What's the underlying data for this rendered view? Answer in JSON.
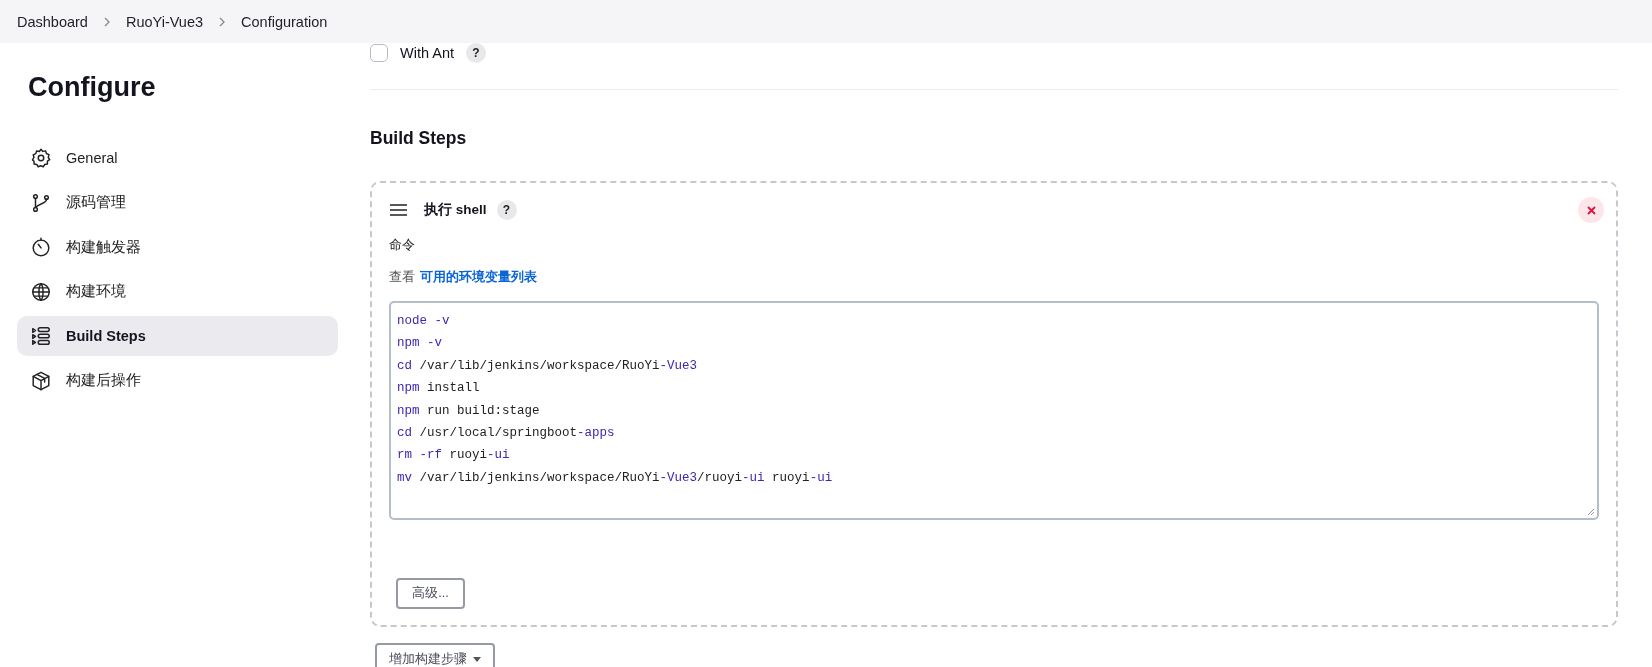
{
  "breadcrumbs": [
    {
      "label": "Dashboard"
    },
    {
      "label": "RuoYi-Vue3"
    },
    {
      "label": "Configuration"
    }
  ],
  "sidebar": {
    "title": "Configure",
    "items": [
      {
        "label": "General",
        "kind": "gear",
        "selected": false
      },
      {
        "label": "源码管理",
        "kind": "branch",
        "selected": false
      },
      {
        "label": "构建触发器",
        "kind": "timer",
        "selected": false
      },
      {
        "label": "构建环境",
        "kind": "globe",
        "selected": false
      },
      {
        "label": "Build Steps",
        "kind": "steps",
        "selected": true
      },
      {
        "label": "构建后操作",
        "kind": "package",
        "selected": false
      }
    ]
  },
  "options": [
    {
      "label": "With Ant",
      "checked": false,
      "help": "?"
    }
  ],
  "section_title": "Build Steps",
  "build_step": {
    "title": "执行 shell",
    "help": "?",
    "field_label": "命令",
    "env_prefix": "查看",
    "env_link": "可用的环境变量列表",
    "code_lines": [
      [
        {
          "text": "node",
          "kind": "keyword"
        },
        {
          "text": " -v",
          "kind": "keyword"
        }
      ],
      [
        {
          "text": "npm",
          "kind": "keyword"
        },
        {
          "text": " -v",
          "kind": "keyword"
        }
      ],
      [
        {
          "text": "cd",
          "kind": "keyword"
        },
        {
          "text": " /var/lib/jenkins/workspace/RuoYi",
          "kind": "plain"
        },
        {
          "text": "-Vue3",
          "kind": "keyword"
        }
      ],
      [
        {
          "text": "npm",
          "kind": "keyword"
        },
        {
          "text": " install",
          "kind": "plain"
        }
      ],
      [
        {
          "text": "npm",
          "kind": "keyword"
        },
        {
          "text": " run build:stage",
          "kind": "plain"
        }
      ],
      [
        {
          "text": "cd",
          "kind": "keyword"
        },
        {
          "text": " /usr/local/springboot",
          "kind": "plain"
        },
        {
          "text": "-apps",
          "kind": "keyword"
        }
      ],
      [
        {
          "text": "rm",
          "kind": "keyword"
        },
        {
          "text": " -rf",
          "kind": "keyword"
        },
        {
          "text": " ruoyi",
          "kind": "plain"
        },
        {
          "text": "-ui",
          "kind": "keyword"
        }
      ],
      [
        {
          "text": "mv",
          "kind": "keyword"
        },
        {
          "text": " /var/lib/jenkins/workspace/RuoYi",
          "kind": "plain"
        },
        {
          "text": "-Vue3",
          "kind": "keyword"
        },
        {
          "text": "/ruoyi",
          "kind": "plain"
        },
        {
          "text": "-ui",
          "kind": "keyword"
        },
        {
          "text": " ruoyi",
          "kind": "plain"
        },
        {
          "text": "-ui",
          "kind": "keyword"
        }
      ]
    ],
    "advanced_button": "高级..."
  },
  "add_step_button": "增加构建步骤"
}
